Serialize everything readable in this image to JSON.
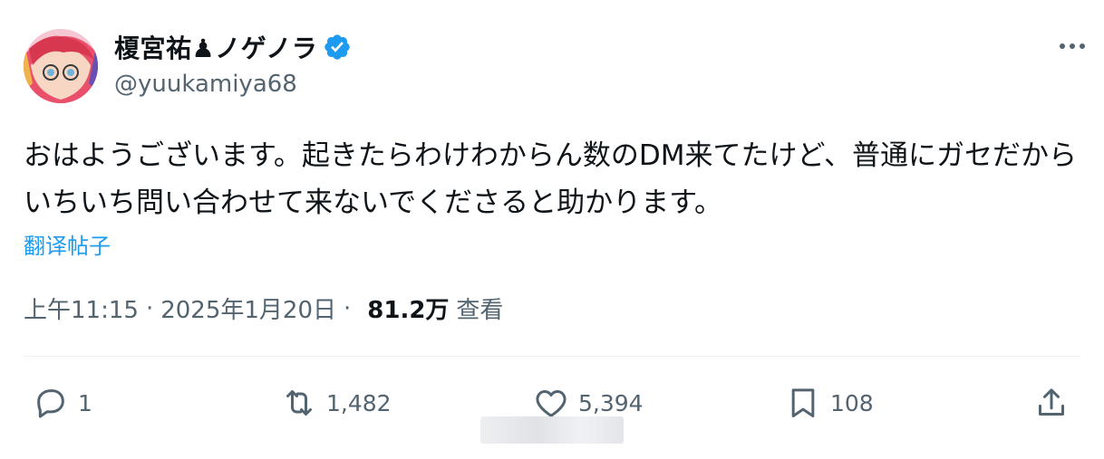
{
  "author": {
    "display_name": "榎宮祐♟ノゲノラ",
    "handle": "@yuukamiya68"
  },
  "tweet": {
    "text": "おはようございます。起きたらわけわからん数のDM来てたけど、普通にガセだからいちいち問い合わせて来ないでくださると助かります。",
    "translate_label": "翻译帖子"
  },
  "meta": {
    "time": "上午11:15",
    "separator": "·",
    "date": "2025年1月20日",
    "views_count": "81.2万",
    "views_label": "查看"
  },
  "actions": {
    "reply_count": "1",
    "retweet_count": "1,482",
    "like_count": "5,394",
    "bookmark_count": "108"
  },
  "colors": {
    "accent": "#1d9bf0",
    "secondary_text": "#536471",
    "primary_text": "#0f1419"
  },
  "icons": [
    "verified-badge-icon",
    "more-icon",
    "reply-icon",
    "retweet-icon",
    "like-icon",
    "bookmark-icon",
    "share-icon"
  ]
}
